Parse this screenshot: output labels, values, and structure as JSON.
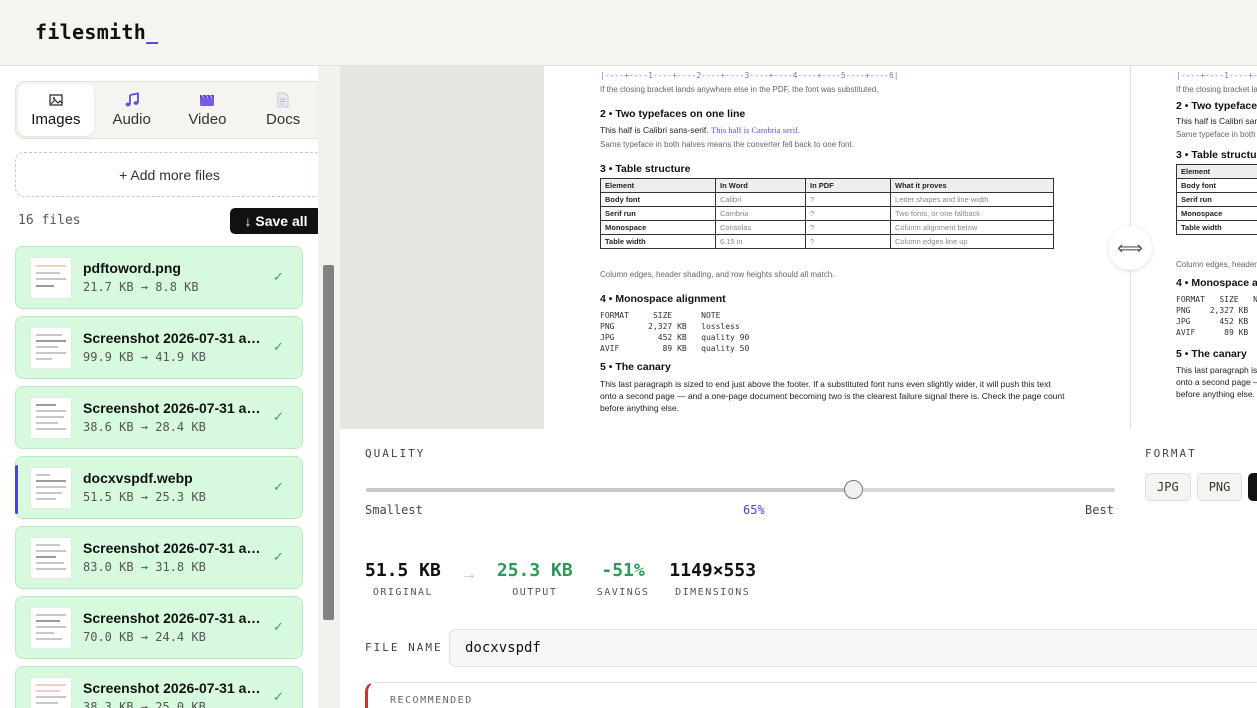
{
  "app": {
    "logo": "filesmith",
    "logo_cursor": "_"
  },
  "tabs": [
    {
      "label": "Images",
      "icon": "image-icon",
      "active": true
    },
    {
      "label": "Audio",
      "icon": "music-note-icon"
    },
    {
      "label": "Video",
      "icon": "film-icon"
    },
    {
      "label": "Docs",
      "icon": "document-icon"
    }
  ],
  "sidebar": {
    "add_files_label": "+ Add more files",
    "file_count": "16 files",
    "save_all_label": "↓ Save all",
    "files": [
      {
        "name": "pdftoword.png",
        "size": "21.7 KB → 8.8 KB",
        "status": "✓"
      },
      {
        "name": "Screenshot 2026-07-31 at…",
        "size": "99.9 KB → 41.9 KB",
        "status": "✓"
      },
      {
        "name": "Screenshot 2026-07-31 at…",
        "size": "38.6 KB → 28.4 KB",
        "status": "✓"
      },
      {
        "name": "docxvspdf.webp",
        "size": "51.5 KB → 25.3 KB",
        "status": "✓",
        "selected": true
      },
      {
        "name": "Screenshot 2026-07-31 at…",
        "size": "83.0 KB → 31.8 KB",
        "status": "✓"
      },
      {
        "name": "Screenshot 2026-07-31 at…",
        "size": "70.0 KB → 24.4 KB",
        "status": "✓"
      },
      {
        "name": "Screenshot 2026-07-31 at…",
        "size": "38.3 KB → 25.0 KB",
        "status": "✓"
      }
    ]
  },
  "preview": {
    "handle_glyph": "⟺",
    "doc": {
      "ruler": "|----+----1----+----2----+----3----+----4----+----5----+----6|",
      "ruler_note": "If the closing bracket lands anywhere else in the PDF, the font was substituted.",
      "s2_title": "2 • Two typefaces on one line",
      "s2_sans": "This half is Calibri sans-serif.",
      "s2_serif": "This half is Cambria serif.",
      "s2_note": "Same typeface in both halves means the converter fell back to one font.",
      "s3_title": "3 • Table structure",
      "table_headers": [
        "Element",
        "In Word",
        "In PDF",
        "What it proves"
      ],
      "table_rows": [
        [
          "Body font",
          "Calibri",
          "?",
          "Letter shapes and line width"
        ],
        [
          "Serif run",
          "Cambria",
          "?",
          "Two fonts, or one fallback"
        ],
        [
          "Monospace",
          "Consolas",
          "?",
          "Column alignment below"
        ],
        [
          "Table width",
          "6.15 in",
          "?",
          "Column edges line up"
        ]
      ],
      "s3_note": "Column edges, header shading, and row heights should all match.",
      "s4_title": "4 • Monospace alignment",
      "mono_block": "FORMAT     SIZE      NOTE\nPNG       2,327 KB   lossless\nJPG         452 KB   quality 90\nAVIF         89 KB   quality 50",
      "s5_title": "5 • The canary",
      "s5_lines": [
        "This last paragraph is sized to end just above the footer. If a substituted font runs even slightly wider, it will push this text",
        "onto a second page — and a one-page document becoming two is the clearest failure signal there is. Check the page count",
        "before anything else."
      ],
      "right_ruler": "|----+----1----+----2-",
      "right_ruler_note": "If the closing bracket lan",
      "right_s2_title": "2 • Two typefaces o",
      "right_s2_line": "This half is Calibri san",
      "right_s2_note": "Same typeface in both ha",
      "right_s3_title": "3 • Table structure",
      "right_table_rows": [
        "Element",
        "Body font",
        "Serif run",
        "Monospace",
        "Table width"
      ],
      "right_s3_note": "Column edges, header sh",
      "right_s4_title": "4 • Monospace alig",
      "right_mono_block": "FORMAT   SIZE   N\nPNG    2,327 KB  lo\nJPG      452 KB  qu\nAVIF      89 KB  qu",
      "right_s5_title": "5 • The canary",
      "right_s5_lines": [
        "This last paragraph is",
        "onto a second page —",
        "before anything else."
      ]
    }
  },
  "settings": {
    "quality_label": "QUALITY",
    "quality_value": 0.65,
    "quality_pct": "65%",
    "smallest_label": "Smallest",
    "best_label": "Best",
    "format_label": "FORMAT",
    "formats": [
      "JPG",
      "PNG",
      ""
    ],
    "active_format_index": 2,
    "stats": {
      "original": "51.5 KB",
      "original_cap": "ORIGINAL",
      "arrow": "→",
      "output": "25.3 KB",
      "output_cap": "OUTPUT",
      "savings": "-51%",
      "savings_cap": "SAVINGS",
      "dimensions": "1149×553",
      "dimensions_cap": "DIMENSIONS"
    },
    "file_name_label": "FILE NAME",
    "file_name_value": "docxvspdf",
    "recommended_label": "RECOMMENDED"
  },
  "colors": {
    "accent": "#4a44d6",
    "success_bg": "#d7fadf",
    "success_text": "#2a9a57",
    "warning_edge": "#c0392b"
  }
}
